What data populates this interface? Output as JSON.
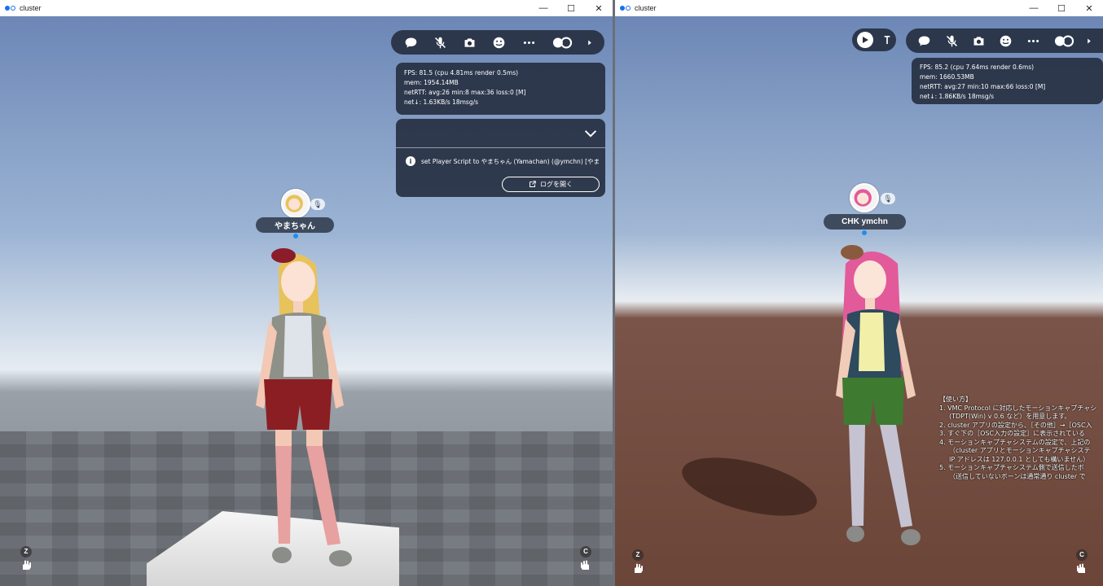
{
  "windows": {
    "left": {
      "title": "cluster",
      "stats": {
        "fps": "FPS: 81.5 (cpu 4.81ms render 0.5ms)",
        "mem": "mem: 1954.14MB",
        "netrtt": "netRTT: avg:26 min:8 max:36 loss:0 [M]",
        "net": "net↓: 1.63KB/s 18msg/s"
      },
      "log": {
        "message": "set Player Script to やまちゃん (Yamachan) (@ymchn) [やま",
        "open_button": "ログを開く"
      },
      "player": {
        "name": "やまちゃん"
      },
      "keys": {
        "left": "Z",
        "right": "C"
      }
    },
    "right": {
      "title": "cluster",
      "stats": {
        "fps": "FPS: 85.2 (cpu 7.64ms render 0.6ms)",
        "mem": "mem: 1660.53MB",
        "netrtt": "netRTT: avg:27 min:10 max:66 loss:0 [M]",
        "net": "net↓: 1.86KB/s 18msg/s"
      },
      "player": {
        "name": "CHK ymchn"
      },
      "keys": {
        "left": "Z",
        "right": "C"
      },
      "instructions": [
        "【使い方】",
        "1. VMC Protocol に対応したモーションキャプチャシ",
        "(TDPT(Win) v 0.6 など）を用意します。",
        "2. cluster アプリの設定から、［その他］→［OSC入",
        "3. すぐ下の［OSC入力の設定］に表示されている",
        "4. モーションキャプチャシステムの設定で、上記の",
        "（cluster アプリとモーションキャプチャシステ",
        "IP アドレスは 127.0.0.1 としても構いません）",
        "5. モーションキャプチャシステム側で送信したボ",
        "（送信していないボーンは通常通り cluster で"
      ]
    }
  },
  "window_controls": {
    "minimize": "—",
    "maximize": "☐",
    "close": "✕"
  },
  "toolbar_icons": [
    "chat-bubble-icon",
    "mic-muted-icon",
    "camera-icon",
    "emoji-icon",
    "more-icon",
    "gamepad-icon",
    "chevron-right-icon"
  ],
  "colors": {
    "panel": "#263042",
    "accent": "#1f8ef0"
  }
}
